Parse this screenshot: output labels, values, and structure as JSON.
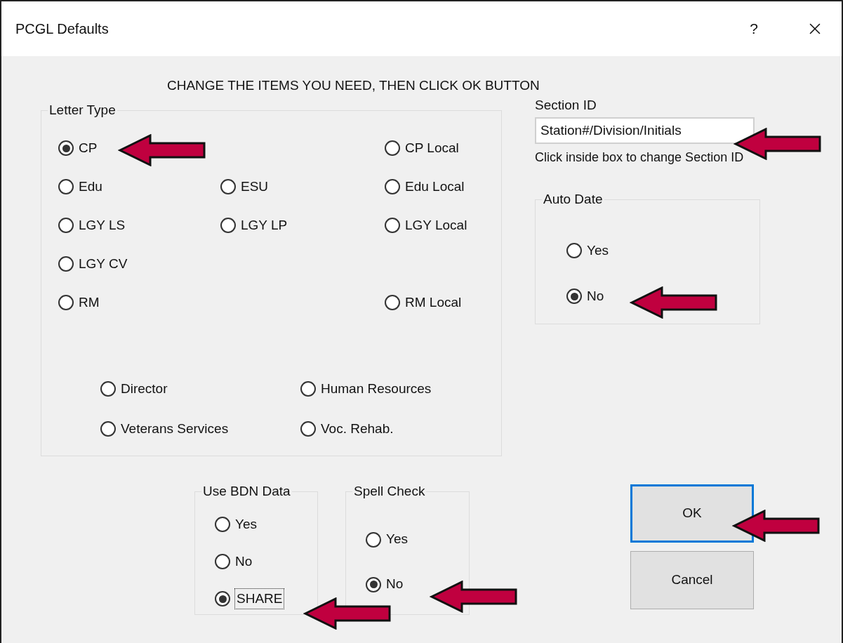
{
  "window": {
    "title": "PCGL Defaults",
    "help": "?"
  },
  "instruction": "CHANGE THE ITEMS YOU NEED, THEN CLICK OK BUTTON",
  "letter_type": {
    "legend": "Letter Type",
    "rows": [
      [
        {
          "label": "CP",
          "selected": true
        },
        null,
        {
          "label": "CP Local",
          "selected": false
        }
      ],
      [
        {
          "label": "Edu",
          "selected": false
        },
        {
          "label": "ESU",
          "selected": false
        },
        {
          "label": "Edu Local",
          "selected": false
        }
      ],
      [
        {
          "label": "LGY LS",
          "selected": false
        },
        {
          "label": "LGY LP",
          "selected": false
        },
        {
          "label": "LGY Local",
          "selected": false
        }
      ],
      [
        {
          "label": "LGY CV",
          "selected": false
        },
        null,
        null
      ],
      [
        {
          "label": "RM",
          "selected": false
        },
        null,
        {
          "label": "RM Local",
          "selected": false
        }
      ]
    ],
    "other_rows": [
      [
        {
          "label": "Director",
          "selected": false
        },
        {
          "label": "Human Resources",
          "selected": false
        }
      ],
      [
        {
          "label": "Veterans Services",
          "selected": false
        },
        {
          "label": "Voc. Rehab.",
          "selected": false
        }
      ]
    ]
  },
  "section_id": {
    "label": "Section ID",
    "value": "Station#/Division/Initials",
    "hint": "Click inside box to change Section ID"
  },
  "auto_date": {
    "legend": "Auto Date",
    "options": [
      {
        "label": "Yes",
        "selected": false
      },
      {
        "label": "No",
        "selected": true
      }
    ]
  },
  "use_bdn_data": {
    "legend": "Use BDN Data",
    "options": [
      {
        "label": "Yes",
        "selected": false,
        "focused": false
      },
      {
        "label": "No",
        "selected": false,
        "focused": false
      },
      {
        "label": "SHARE",
        "selected": true,
        "focused": true
      }
    ]
  },
  "spell_check": {
    "legend": "Spell Check",
    "options": [
      {
        "label": "Yes",
        "selected": false
      },
      {
        "label": "No",
        "selected": true
      }
    ]
  },
  "buttons": [
    {
      "label": "OK",
      "default": true
    },
    {
      "label": "Cancel",
      "default": false
    }
  ]
}
